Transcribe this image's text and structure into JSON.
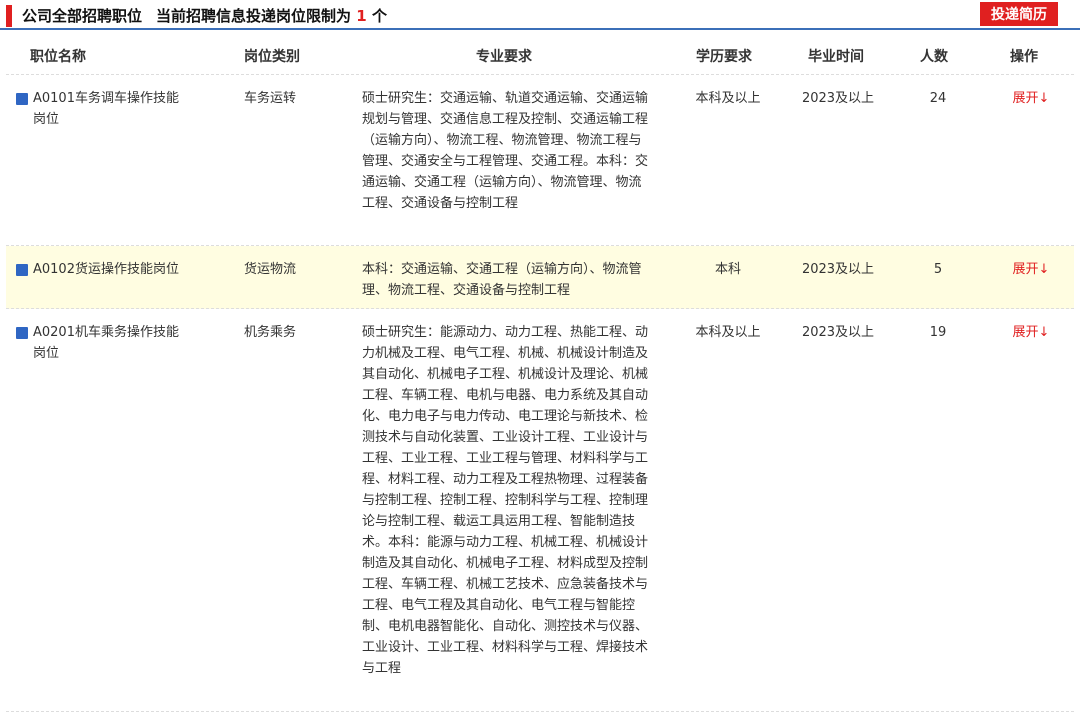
{
  "header": {
    "title": "公司全部招聘职位",
    "limit_prefix": "当前招聘信息投递岗位限制为",
    "limit_count": "1",
    "limit_suffix": "个",
    "apply_button": "投递简历"
  },
  "table": {
    "columns": [
      "职位名称",
      "岗位类别",
      "专业要求",
      "学历要求",
      "毕业时间",
      "人数",
      "操作"
    ],
    "rows": [
      {
        "name": "A0101车务调车操作技能岗位",
        "category": "车务运转",
        "major": "硕士研究生：交通运输、轨道交通运输、交通运输规划与管理、交通信息工程及控制、交通运输工程（运输方向）、物流工程、物流管理、物流工程与管理、交通安全与工程管理、交通工程。本科：交通运输、交通工程（运输方向）、物流管理、物流工程、交通设备与控制工程",
        "education": "本科及以上",
        "graduation": "2023及以上",
        "count": "24",
        "action": "展开↓"
      },
      {
        "name": "A0102货运操作技能岗位",
        "category": "货运物流",
        "major": "本科：交通运输、交通工程（运输方向）、物流管理、物流工程、交通设备与控制工程",
        "education": "本科",
        "graduation": "2023及以上",
        "count": "5",
        "action": "展开↓"
      },
      {
        "name": "A0201机车乘务操作技能岗位",
        "category": "机务乘务",
        "major": "硕士研究生：能源动力、动力工程、热能工程、动力机械及工程、电气工程、机械、机械设计制造及其自动化、机械电子工程、机械设计及理论、机械工程、车辆工程、电机与电器、电力系统及其自动化、电力电子与电力传动、电工理论与新技术、检测技术与自动化装置、工业设计工程、工业设计与工程、工业工程、工业工程与管理、材料科学与工程、材料工程、动力工程及工程热物理、过程装备与控制工程、控制工程、控制科学与工程、控制理论与控制工程、载运工具运用工程、智能制造技术。本科：能源与动力工程、机械工程、机械设计制造及其自动化、机械电子工程、材料成型及控制工程、车辆工程、机械工艺技术、应急装备技术与工程、电气工程及其自动化、电气工程与智能控制、电机电器智能化、自动化、测控技术与仪器、工业设计、工业工程、材料科学与工程、焊接技术与工程",
        "education": "本科及以上",
        "graduation": "2023及以上",
        "count": "19",
        "action": "展开↓"
      }
    ]
  },
  "colors": {
    "accent_red": "#e02020",
    "divider_blue": "#3b6fb8",
    "bullet_blue": "#2f66c3",
    "highlight_row": "#fffde1"
  }
}
